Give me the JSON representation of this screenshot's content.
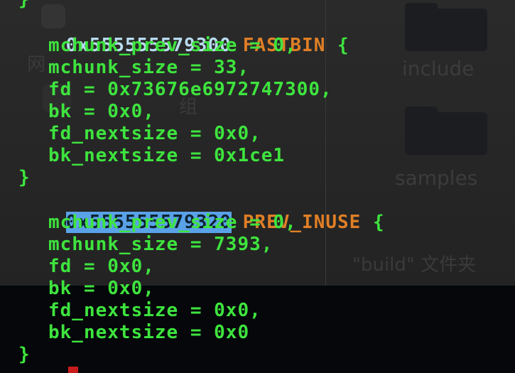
{
  "background": {
    "folder_labels": [
      "include",
      "samples"
    ],
    "bottom_text": "\"build\" 文件夹",
    "ghost_text_1": "网",
    "ghost_text_2": "组"
  },
  "chunks": [
    {
      "address": "0x555555579300",
      "type": "FASTBIN",
      "selected": false,
      "fields": [
        "mchunk_prev_size = 0,",
        "mchunk_size = 33,",
        "fd = 0x73676e6972747300,",
        "bk = 0x0,",
        "fd_nextsize = 0x0,",
        "bk_nextsize = 0x1ce1"
      ]
    },
    {
      "address": "0x555555579320",
      "type": "PREV_INUSE",
      "selected": true,
      "fields": [
        "mchunk_prev_size = 0,",
        "mchunk_size = 7393,",
        "fd = 0x0,",
        "bk = 0x0,",
        "fd_nextsize = 0x0,",
        "bk_nextsize = 0x0"
      ]
    }
  ],
  "braces": {
    "open": "{",
    "close": "}"
  },
  "colors": {
    "green": "#3ee43e",
    "address": "#b9dcf0",
    "type": "#e07f26",
    "selection": "#5aa2e8"
  }
}
